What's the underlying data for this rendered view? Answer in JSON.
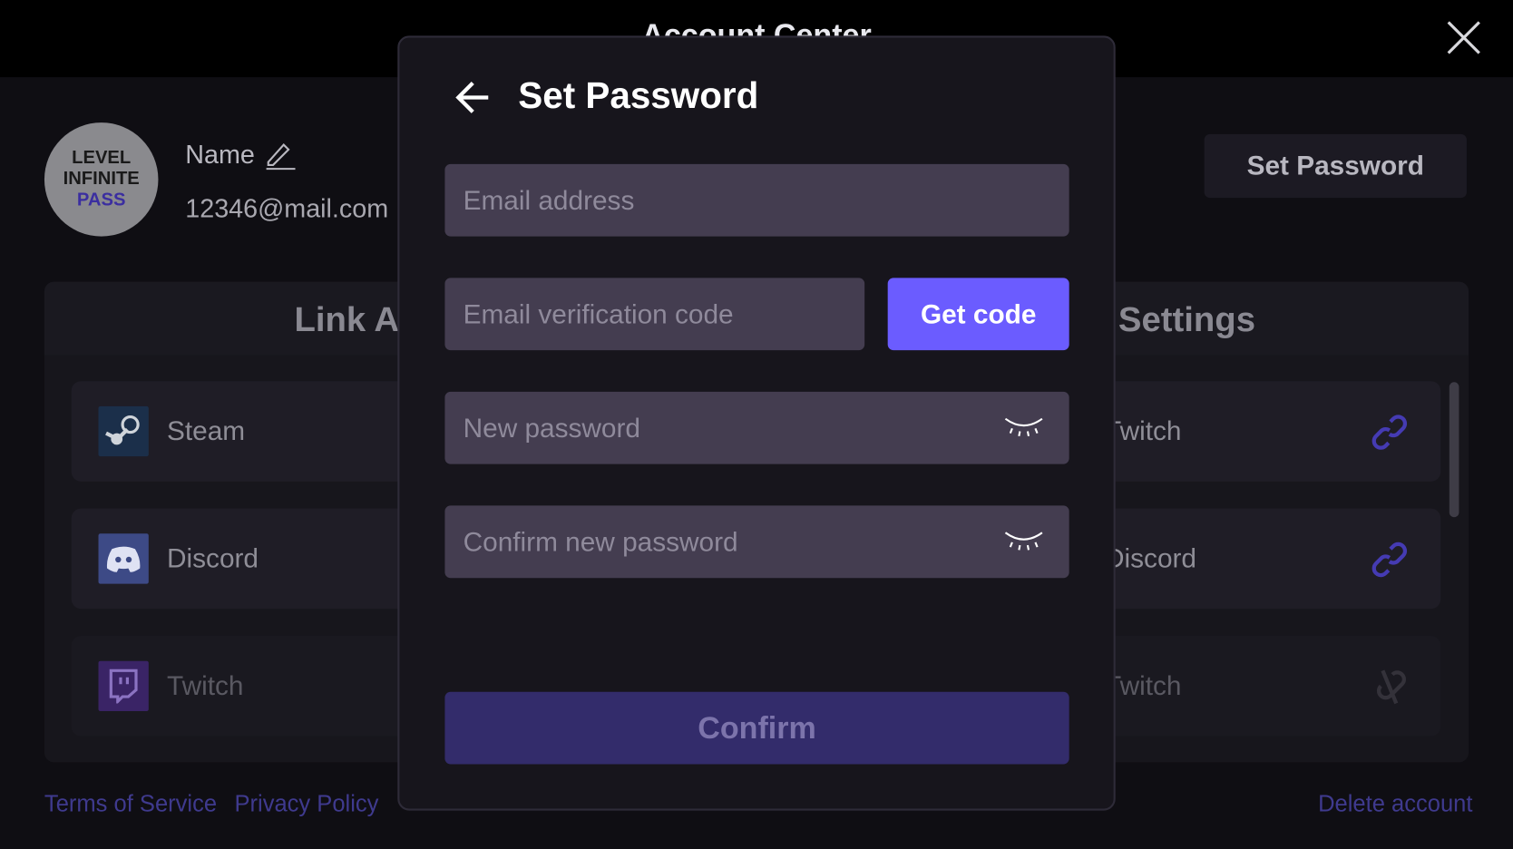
{
  "header": {
    "title": "Account Center",
    "close_icon": "close-icon"
  },
  "profile": {
    "avatar_lines": [
      "LEVEL",
      "INFINITE",
      "PASS"
    ],
    "name": "Name",
    "email": "12346@mail.com",
    "set_password_label": "Set Password"
  },
  "panel": {
    "left_title": "Link Accounts",
    "right_title": "Settings",
    "left_items": [
      {
        "label": "Steam",
        "icon": "steam-icon"
      },
      {
        "label": "Discord",
        "icon": "discord-icon"
      },
      {
        "label": "Twitch",
        "icon": "twitch-icon"
      }
    ],
    "right_items": [
      {
        "label": "Twitch",
        "icon": "link-icon"
      },
      {
        "label": "Discord",
        "icon": "link-icon"
      },
      {
        "label": "Twitch",
        "icon": "unlink-icon"
      }
    ]
  },
  "footer": {
    "terms": "Terms of Service",
    "privacy": "Privacy Policy",
    "delete": "Delete account"
  },
  "modal": {
    "title": "Set Password",
    "email_placeholder": "Email address",
    "code_placeholder": "Email verification code",
    "get_code_label": "Get code",
    "new_password_placeholder": "New password",
    "confirm_password_placeholder": "Confirm new password",
    "confirm_label": "Confirm"
  },
  "colors": {
    "accent": "#6b5cff",
    "confirm_disabled": "#332c6b",
    "input_bg": "#443d50",
    "link": "#3f3a8e"
  }
}
